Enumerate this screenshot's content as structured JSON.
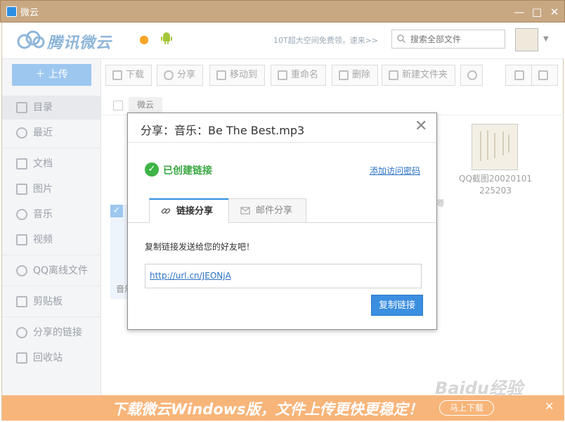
{
  "window": {
    "title": "微云"
  },
  "header": {
    "logo_text": "腾讯微云",
    "promo": "10T超大空间免费领，速来>>",
    "search_placeholder": "搜索全部文件"
  },
  "sidebar": {
    "upload_label": "上传",
    "items": [
      {
        "label": "目录"
      },
      {
        "label": "最近"
      },
      {
        "label": "文档"
      },
      {
        "label": "图片"
      },
      {
        "label": "音乐"
      },
      {
        "label": "视频"
      },
      {
        "label": "QQ离线文件"
      },
      {
        "label": "剪贴板"
      },
      {
        "label": "分享的链接"
      },
      {
        "label": "回收站"
      }
    ]
  },
  "toolbar": {
    "download": "下载",
    "share": "分享",
    "move": "移动到",
    "rename": "重命名",
    "delete": "删除",
    "new_folder": "新建文件夹"
  },
  "breadcrumb": {
    "root": "微云"
  },
  "files": {
    "partial_label": "音乐",
    "partial_right": "噂",
    "thumb_name_1": "QQ截图20020101",
    "thumb_name_2": "225203"
  },
  "banner": {
    "text": "下载微云Windows版，文件上传更快更稳定！",
    "button": "马上下载"
  },
  "watermark": "Baidu经验",
  "dialog": {
    "title": "分享：音乐：Be The Best.mp3",
    "created": "已创建链接",
    "add_password": "添加访问密码",
    "tabs": {
      "link": "链接分享",
      "mail": "邮件分享"
    },
    "instruction": "复制链接发送给您的好友吧！",
    "link": "http://url.cn/JEONjA",
    "copy_button": "复制链接"
  }
}
